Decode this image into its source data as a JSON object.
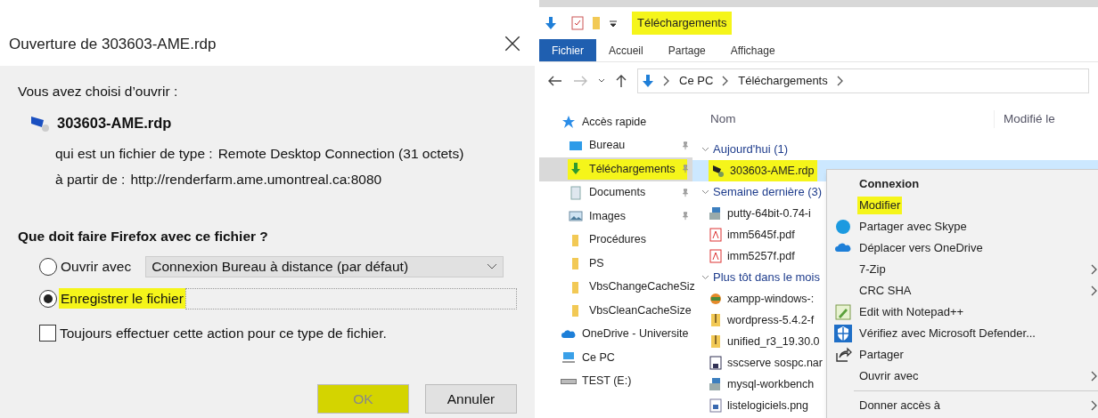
{
  "dialog": {
    "title": "Ouverture de 303603-AME.rdp",
    "intro": "Vous avez choisi d’ouvrir :",
    "file_name": "303603-AME.rdp",
    "type_label": "qui est un fichier de type :",
    "type_value": "Remote Desktop Connection (31 octets)",
    "from_label": "à partir de :",
    "from_value": "http://renderfarm.ame.umontreal.ca:8080",
    "question": "Que doit faire Firefox avec ce fichier ?",
    "options": [
      {
        "label": "Ouvrir avec",
        "selected": false,
        "highlighted": false,
        "app": "Connexion Bureau à distance (par défaut)"
      },
      {
        "label": "Enregistrer le fichier",
        "selected": true,
        "highlighted": true
      }
    ],
    "always": {
      "label": "Toujours effectuer cette action pour ce type de fichier.",
      "checked": false
    },
    "buttons": [
      {
        "label": "OK",
        "highlighted": true,
        "disabled": true
      },
      {
        "label": "Annuler",
        "highlighted": false,
        "disabled": false
      }
    ]
  },
  "explorer": {
    "title": "Téléchargements",
    "title_highlighted": true,
    "ribbon_tabs": [
      {
        "label": "Fichier",
        "selected": true
      },
      {
        "label": "Accueil",
        "selected": false
      },
      {
        "label": "Partage",
        "selected": false
      },
      {
        "label": "Affichage",
        "selected": false
      }
    ],
    "breadcrumb": [
      "Ce PC",
      "Téléchargements"
    ],
    "columns": [
      "Nom",
      "Modifié le"
    ],
    "nav": [
      {
        "label": "Accès rapide",
        "kind": "star",
        "pinned": false,
        "selected": false,
        "highlighted": false
      },
      {
        "label": "Bureau",
        "kind": "desktop",
        "pinned": true,
        "selected": false,
        "highlighted": false
      },
      {
        "label": "Téléchargements",
        "kind": "download",
        "pinned": true,
        "selected": true,
        "highlighted": true
      },
      {
        "label": "Documents",
        "kind": "document",
        "pinned": true,
        "selected": false,
        "highlighted": false
      },
      {
        "label": "Images",
        "kind": "image",
        "pinned": true,
        "selected": false,
        "highlighted": false
      },
      {
        "label": "Procédures",
        "kind": "folder",
        "pinned": false,
        "selected": false,
        "highlighted": false
      },
      {
        "label": "PS",
        "kind": "folder",
        "pinned": false,
        "selected": false,
        "highlighted": false
      },
      {
        "label": "VbsChangeCacheSiz",
        "kind": "folder",
        "pinned": false,
        "selected": false,
        "highlighted": false
      },
      {
        "label": "VbsCleanCacheSize",
        "kind": "folder",
        "pinned": false,
        "selected": false,
        "highlighted": false
      },
      {
        "label": "OneDrive - Universite",
        "kind": "cloud",
        "pinned": false,
        "selected": false,
        "highlighted": false
      },
      {
        "label": "Ce PC",
        "kind": "pc",
        "pinned": false,
        "selected": false,
        "highlighted": false
      },
      {
        "label": "TEST (E:)",
        "kind": "drive",
        "pinned": false,
        "selected": false,
        "highlighted": false
      }
    ],
    "groups": [
      {
        "label": "Aujourd'hui (1)",
        "files": [
          {
            "name": "303603-AME.rdp",
            "kind": "rdp",
            "selected": true,
            "highlighted": true
          }
        ]
      },
      {
        "label": "Semaine dernière (3)",
        "files": [
          {
            "name": "putty-64bit-0.74-i",
            "kind": "installer",
            "selected": false,
            "highlighted": false
          },
          {
            "name": "imm5645f.pdf",
            "kind": "pdf",
            "selected": false,
            "highlighted": false
          },
          {
            "name": "imm5257f.pdf",
            "kind": "pdf",
            "selected": false,
            "highlighted": false
          }
        ]
      },
      {
        "label": "Plus tôt dans le mois",
        "files": [
          {
            "name": "xampp-windows-:",
            "kind": "xampp",
            "selected": false,
            "highlighted": false
          },
          {
            "name": "wordpress-5.4.2-f",
            "kind": "zip",
            "selected": false,
            "highlighted": false
          },
          {
            "name": "unified_r3_19.30.0",
            "kind": "zip",
            "selected": false,
            "highlighted": false
          },
          {
            "name": "sscserve sospc.nar",
            "kind": "disk",
            "selected": false,
            "highlighted": false
          },
          {
            "name": "mysql-workbench",
            "kind": "installer",
            "selected": false,
            "highlighted": false
          },
          {
            "name": "listelogiciels.png",
            "kind": "image",
            "selected": false,
            "highlighted": false
          }
        ]
      }
    ],
    "menu": [
      {
        "label": "Connexion",
        "kind": "default",
        "submenu": false,
        "highlighted": false
      },
      {
        "label": "Modifier",
        "kind": "plain",
        "submenu": false,
        "highlighted": true
      },
      {
        "label": "Partager avec Skype",
        "kind": "skype",
        "submenu": false,
        "highlighted": false
      },
      {
        "label": "Déplacer vers OneDrive",
        "kind": "cloud",
        "submenu": false,
        "highlighted": false
      },
      {
        "label": "7-Zip",
        "kind": "plain",
        "submenu": true,
        "highlighted": false
      },
      {
        "label": "CRC SHA",
        "kind": "plain",
        "submenu": true,
        "highlighted": false
      },
      {
        "label": "Edit with Notepad++",
        "kind": "notepad",
        "submenu": false,
        "highlighted": false
      },
      {
        "label": "Vérifiez avec Microsoft Defender...",
        "kind": "shield",
        "submenu": false,
        "highlighted": false
      },
      {
        "label": "Partager",
        "kind": "share",
        "submenu": false,
        "highlighted": false
      },
      {
        "label": "Ouvrir avec",
        "kind": "plain",
        "submenu": true,
        "highlighted": false
      },
      {
        "kind": "separator"
      },
      {
        "label": "Donner accès à",
        "kind": "plain",
        "submenu": true,
        "highlighted": false
      }
    ]
  }
}
